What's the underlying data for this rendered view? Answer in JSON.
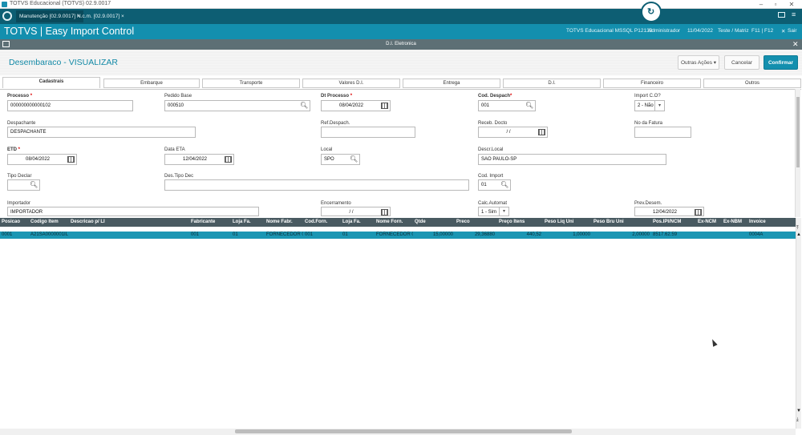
{
  "window": {
    "title": "TOTVS Educacional (TOTVS) 02.9.0017"
  },
  "tabs": [
    {
      "label": "Manutenção [02.9.0017]",
      "close": "×"
    },
    {
      "label": "N.c.m. [02.9.0017]",
      "close": "×"
    }
  ],
  "app": {
    "title": "TOTVS | Easy Import Control",
    "env": "TOTVS Educacional MSSQL P12133",
    "user": "Administrador",
    "date": "11/04/2022",
    "branch": "Teste / Matriz",
    "keys": "F11 | F12",
    "exit": "Sair"
  },
  "dialog": {
    "bar_title": "D.I. Eletronica",
    "title": "Desembaraco - VISUALIZAR",
    "btn_other": "Outras Ações",
    "btn_cancel": "Cancelar",
    "btn_confirm": "Confirmar"
  },
  "folders": [
    "Cadastrais",
    "Embarque",
    "Transporte",
    "Valores D.I.",
    "Entrega",
    "D.I.",
    "Financeiro",
    "Outros"
  ],
  "form": {
    "processo": {
      "label": "Processo",
      "value": "000000000000102"
    },
    "pedido": {
      "label": "Pedido Base",
      "value": "000510"
    },
    "dt_processo": {
      "label": "Dt Processo",
      "value": "08/04/2022"
    },
    "cod_despach": {
      "label": "Cod. Despach",
      "value": "001"
    },
    "import_co": {
      "label": "Import C.O?",
      "value": "2 - Não"
    },
    "despachante": {
      "label": "Despachante",
      "value": "DESPACHANTE"
    },
    "ref_despach": {
      "label": "Ref.Despach.",
      "value": ""
    },
    "receb_docto": {
      "label": "Receb. Docto",
      "value": "/ /"
    },
    "no_fatura": {
      "label": "No da Fatura",
      "value": ""
    },
    "etd": {
      "label": "ETD",
      "value": "08/04/2022"
    },
    "data_eta": {
      "label": "Data ETA",
      "value": "12/04/2022"
    },
    "local": {
      "label": "Local",
      "value": "SPO"
    },
    "descr_local": {
      "label": "Descr.Local",
      "value": "SAO PAULO-SP"
    },
    "tipo_declar": {
      "label": "Tipo Declar",
      "value": ""
    },
    "des_tipo_dec": {
      "label": "Des.Tipo Dec",
      "value": ""
    },
    "cod_import": {
      "label": "Cod. Import",
      "value": "01"
    },
    "importador": {
      "label": "Importador",
      "value": "IMPORTADOR"
    },
    "encerramento": {
      "label": "Encerramento",
      "value": "/ /"
    },
    "calc_automat": {
      "label": "Calc.Automat",
      "value": "1 - Sim"
    },
    "prev_desem": {
      "label": "Prev.Desem.",
      "value": "12/04/2022"
    }
  },
  "grid": {
    "headers": [
      "Posicao",
      "Codigo Item",
      "Descricao p/ LI",
      "Fabricante",
      "Loja Fa.",
      "Nome Fabr.",
      "Cod.Forn.",
      "Loja Fa.",
      "Nome Forn.",
      "Qtde",
      "Preco",
      "Preço Itens",
      "Peso Liq Uni",
      "Peso Bru Uni",
      "Pos.IPI/NCM",
      "Ex-NCM",
      "Ex-NBM",
      "Invoice"
    ],
    "row": [
      "0001",
      "A21SA0000001IL",
      "",
      "001",
      "01",
      "FORNECEDOR 01",
      "001",
      "01",
      "FORNECEDOR 01",
      "15,00000",
      "29,36880",
      "440,52",
      "1,00000",
      "2,00000",
      "8517.62.59",
      "",
      "",
      "0004A"
    ]
  },
  "colors": {
    "header": "#138fae",
    "tabbar": "#0d5e73",
    "grid_head": "#495a61",
    "grid_sel": "#1b96b3"
  }
}
